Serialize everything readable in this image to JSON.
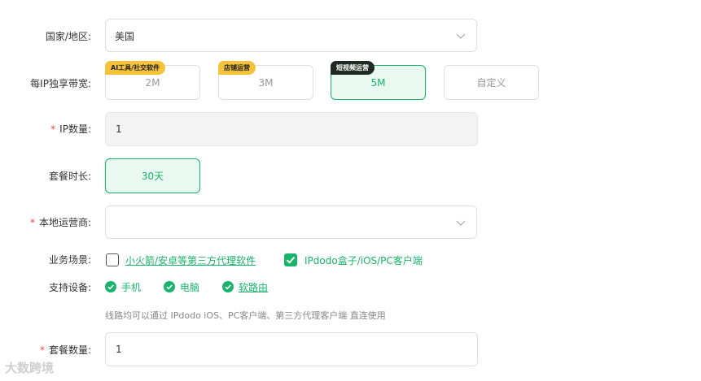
{
  "form": {
    "country_label": "国家/地区:",
    "country_value": "美国",
    "bandwidth_label": "每IP独享带宽:",
    "bandwidth_options": [
      {
        "label": "2M",
        "tag": "AI工具/社交软件"
      },
      {
        "label": "3M",
        "tag": "店铺运营"
      },
      {
        "label": "5M",
        "tag": "短视频运营",
        "selected": true
      },
      {
        "label": "自定义",
        "tag": ""
      }
    ],
    "ip_count_label": "IP数量:",
    "ip_count_value": "1",
    "duration_label": "套餐时长:",
    "duration_value": "30天",
    "isp_label": "本地运营商:",
    "isp_value": "",
    "scene_label": "业务场景:",
    "scene_options": [
      {
        "label": "小火箭/安卓等第三方代理软件",
        "checked": false
      },
      {
        "label": "IPdodo盒子/iOS/PC客户端",
        "checked": true
      }
    ],
    "devices_label": "支持设备:",
    "devices": [
      "手机",
      "电脑",
      "软路由"
    ],
    "hint": "线路均可以通过 IPdodo iOS、PC客户端、第三方代理客户端 直连使用",
    "package_qty_label": "套餐数量:",
    "package_qty_value": "1",
    "required_mark": "*"
  },
  "watermark": "大数跨境",
  "colors": {
    "accent": "#19b36b",
    "tag_yellow": "#f7c23b",
    "tag_dark": "#1f2a24",
    "required": "#e5484d"
  }
}
